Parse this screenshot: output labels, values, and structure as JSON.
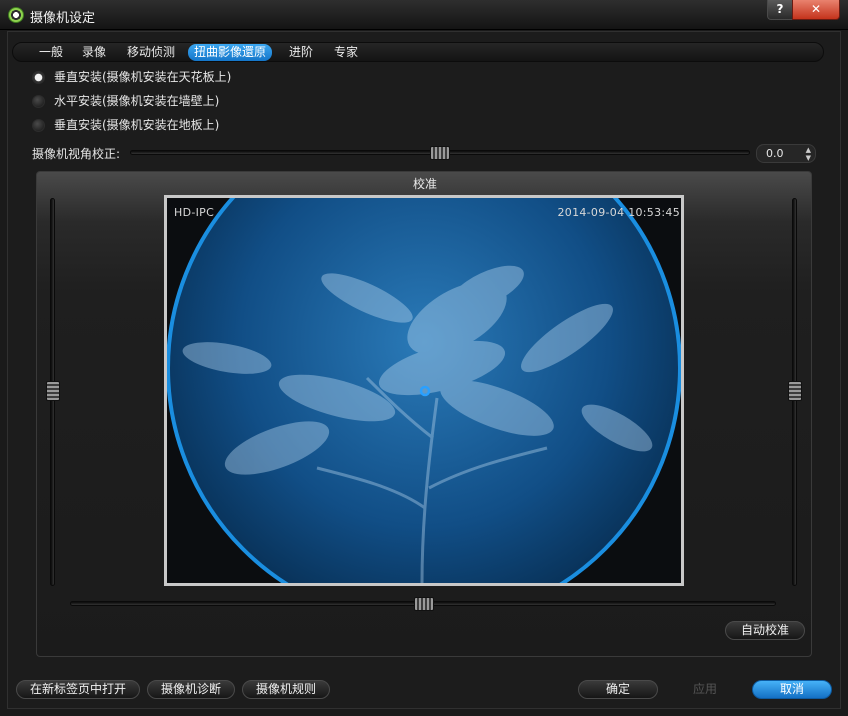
{
  "window": {
    "title": "摄像机设定",
    "help_label": "?",
    "close_label": "✕"
  },
  "tabs": [
    {
      "label": "一般"
    },
    {
      "label": "录像"
    },
    {
      "label": "移动侦测"
    },
    {
      "label": "扭曲影像還原",
      "active": true
    },
    {
      "label": "进阶"
    },
    {
      "label": "专家"
    }
  ],
  "mount_options": [
    {
      "label": "垂直安装(摄像机安装在天花板上)",
      "checked": true
    },
    {
      "label": "水平安装(摄像机安装在墙壁上)",
      "checked": false
    },
    {
      "label": "垂直安装(摄像机安装在地板上)",
      "checked": false
    }
  ],
  "view_angle": {
    "label": "摄像机视角校正:",
    "value": "0.0",
    "position": 0.5
  },
  "calibration": {
    "title": "校准",
    "osd_left": "HD-IPC",
    "osd_right": "2014-09-04  10:53:45",
    "auto_button": "自动校准"
  },
  "footer": {
    "open_new_tab": "在新标签页中打开",
    "diagnose": "摄像机诊断",
    "rules": "摄像机规则",
    "ok": "确定",
    "apply": "应用",
    "cancel": "取消"
  },
  "colors": {
    "accent": "#1a8ee0",
    "fisheye_ring": "#1a8ee0"
  }
}
